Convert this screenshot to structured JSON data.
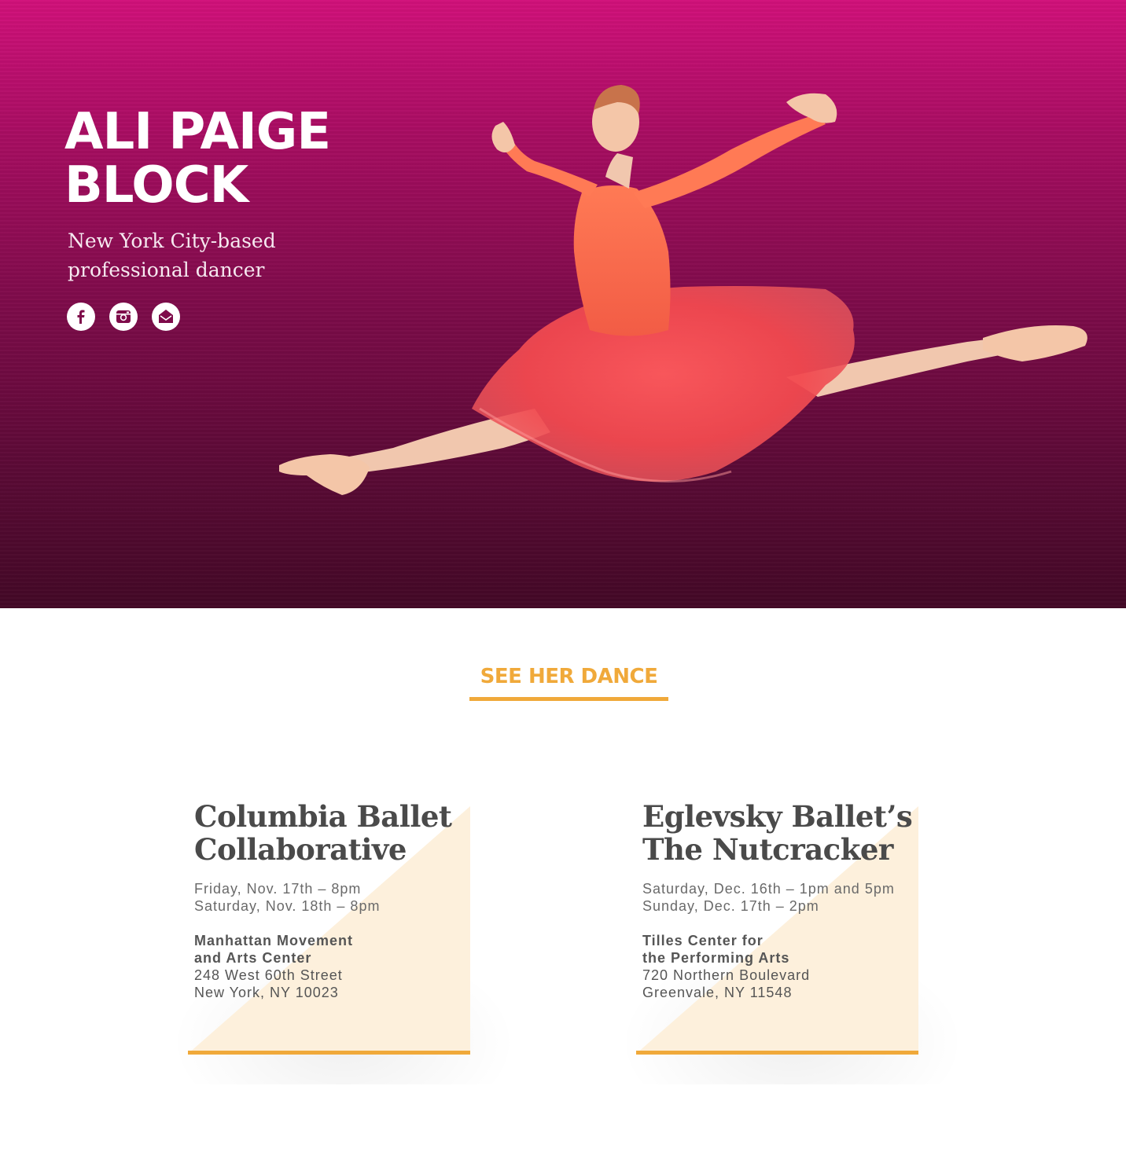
{
  "hero": {
    "name_line1": "ALI PAIGE",
    "name_line2": "BLOCK",
    "subtitle": "New York City-based professional dancer",
    "background_color": "#8a0b50",
    "social": [
      {
        "icon": "facebook-icon"
      },
      {
        "icon": "instagram-icon"
      },
      {
        "icon": "email-icon"
      }
    ]
  },
  "section": {
    "title": "SEE HER DANCE",
    "accent_color": "#f0a93a"
  },
  "events": [
    {
      "title_line1": "Columbia Ballet",
      "title_line2": "Collaborative",
      "date1": "Friday, Nov. 17th – 8pm",
      "date2": "Saturday, Nov. 18th – 8pm",
      "venue_line1": "Manhattan Movement",
      "venue_line2": "and Arts Center",
      "address_line1": "248 West 60th Street",
      "address_line2": "New York, NY 10023"
    },
    {
      "title_line1": "Eglevsky Ballet’s",
      "title_line2": "The Nutcracker",
      "date1": "Saturday, Dec. 16th – 1pm and 5pm",
      "date2": "Sunday, Dec. 17th – 2pm",
      "venue_line1": "Tilles Center for",
      "venue_line2": "the Performing Arts",
      "address_line1": "720 Northern Boulevard",
      "address_line2": "Greenvale, NY 11548"
    }
  ]
}
